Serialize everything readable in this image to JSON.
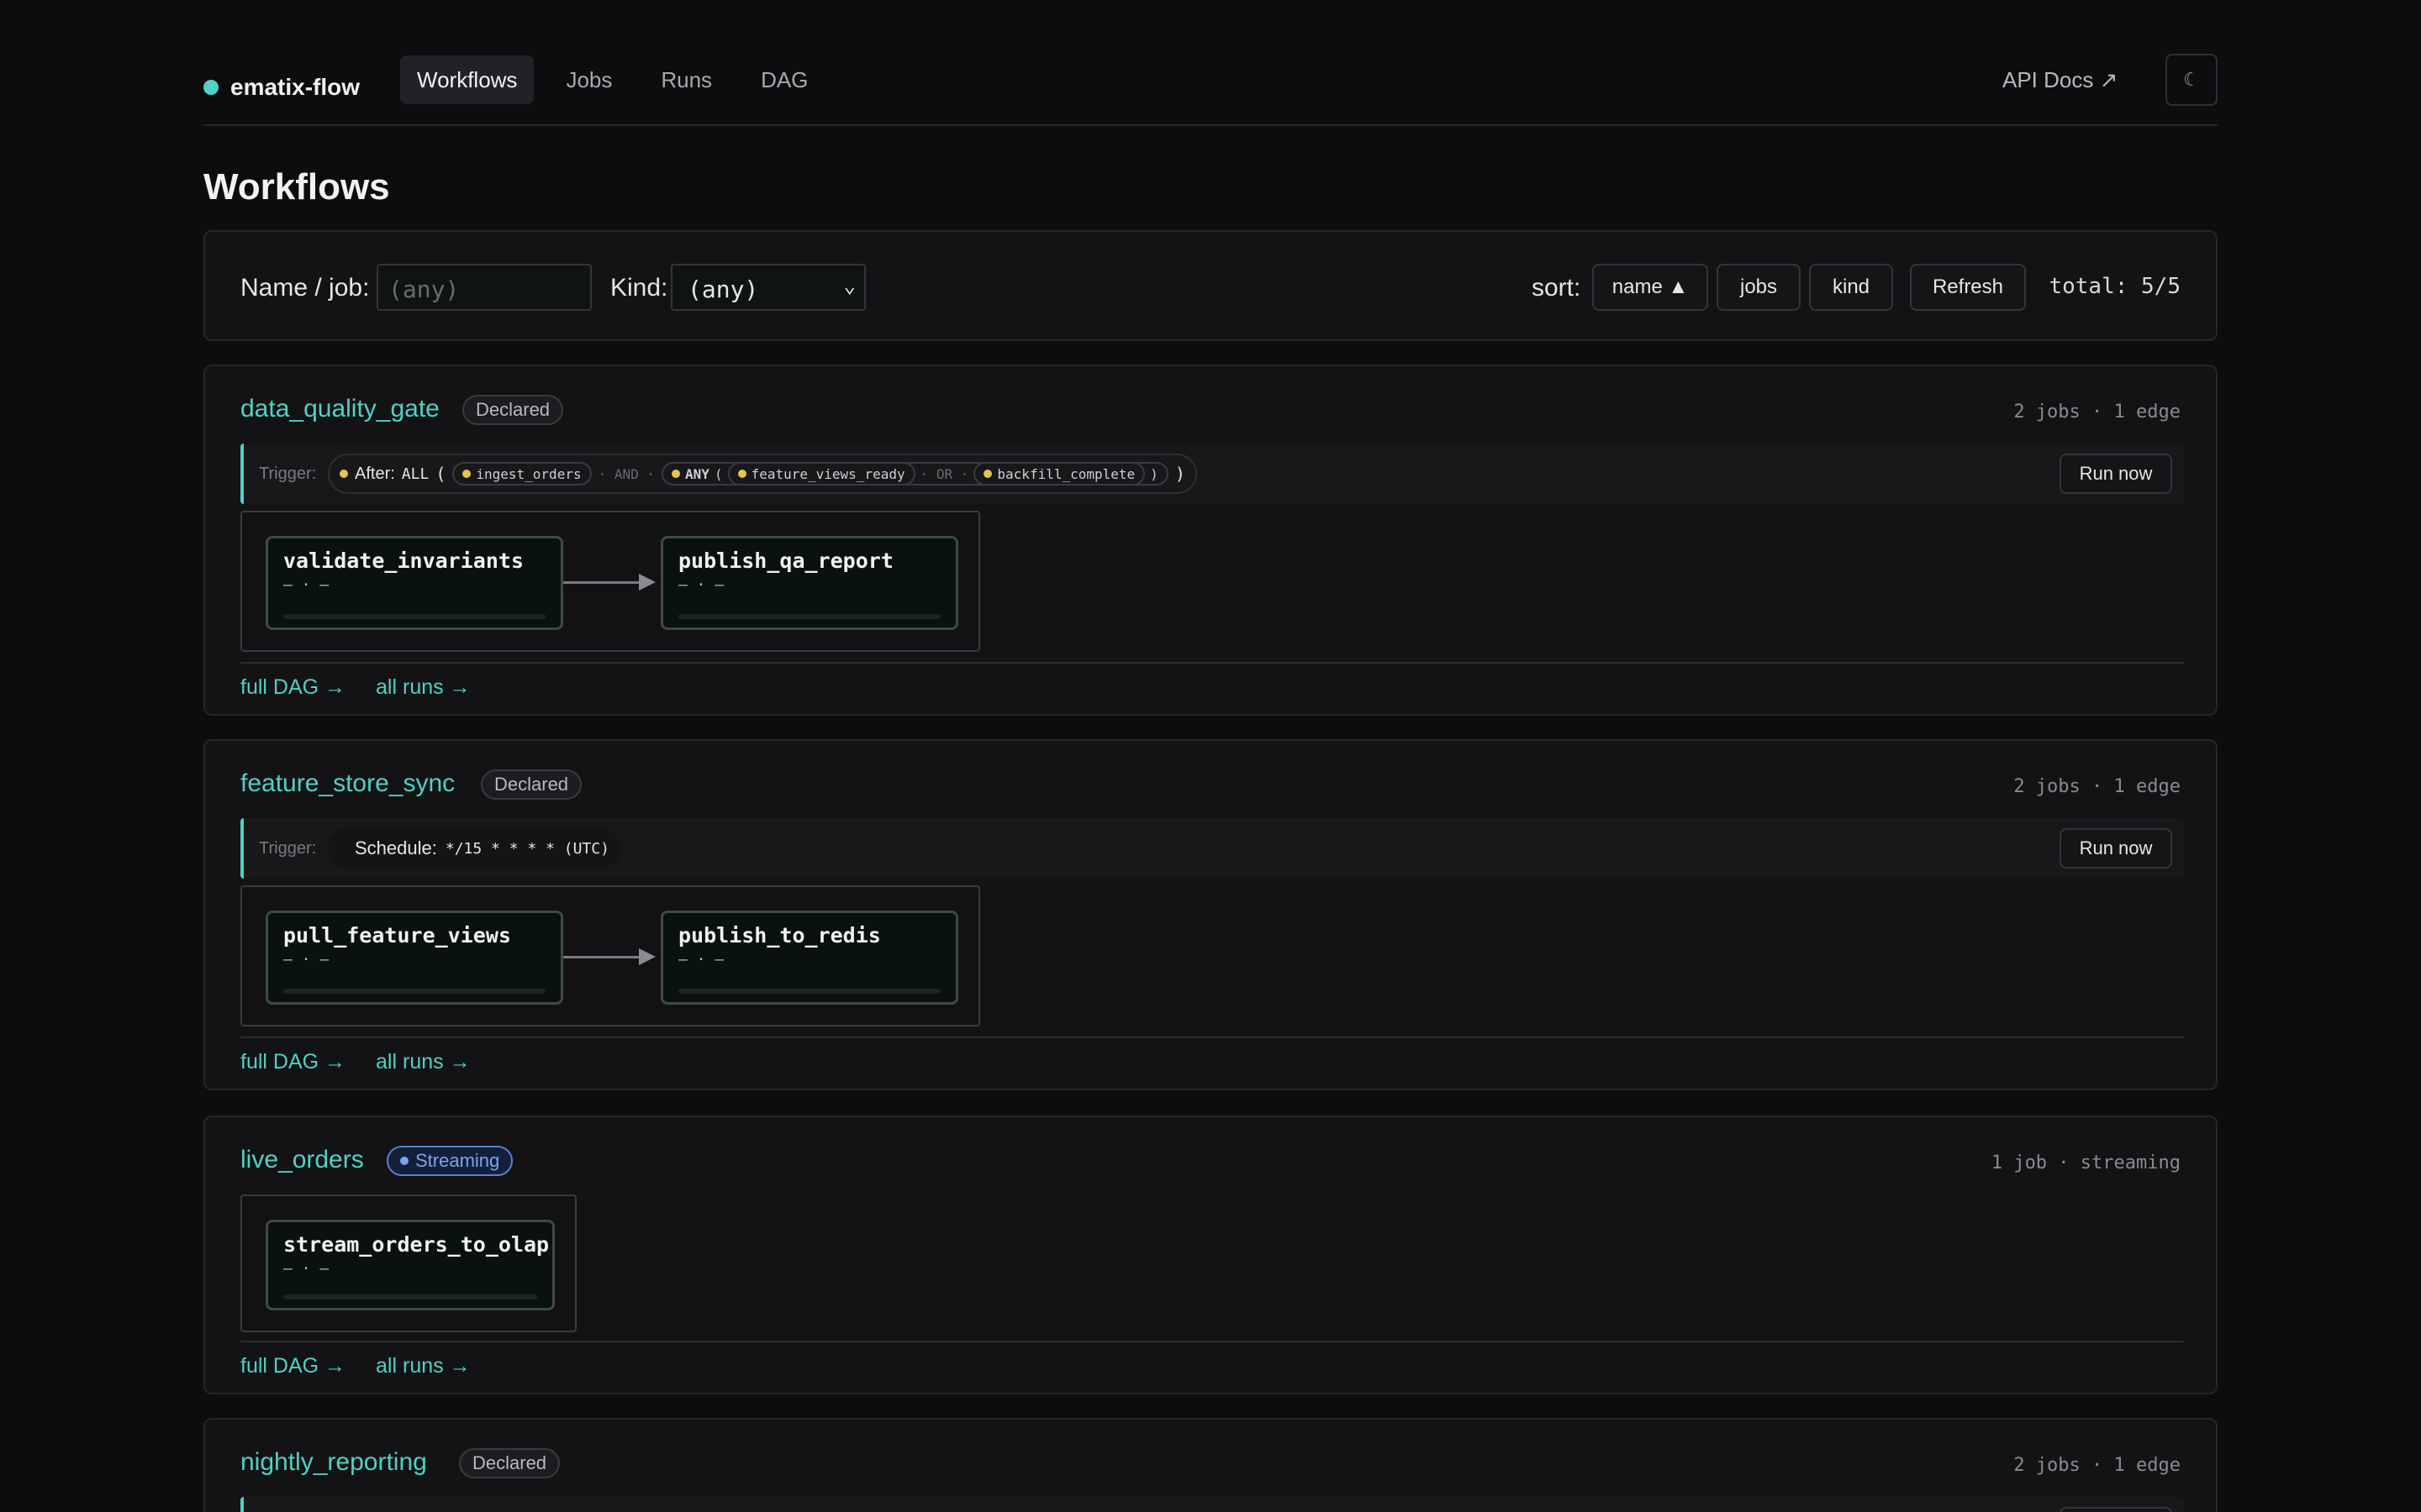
{
  "brand": {
    "name": "ematix-flow"
  },
  "nav": {
    "items": [
      "Workflows",
      "Jobs",
      "Runs",
      "DAG"
    ],
    "api_docs": "API Docs ↗",
    "theme_icon": "☾"
  },
  "page": {
    "title": "Workflows"
  },
  "filters": {
    "name_label": "Name / job:",
    "name_placeholder": "(any)",
    "kind_label": "Kind:",
    "kind_value": "(any)",
    "sort_label": "sort:",
    "sort_buttons": [
      "name ▲",
      "jobs",
      "kind"
    ],
    "refresh": "Refresh",
    "total": "total: 5/5"
  },
  "common": {
    "trigger_label": "Trigger:",
    "run_now": "Run now",
    "full_dag": "full DAG →",
    "all_runs": "all runs →",
    "node_sub": "– · –"
  },
  "workflows": [
    {
      "name": "data_quality_gate",
      "badge": "Declared",
      "meta": "2 jobs · 1 edge",
      "trigger": {
        "prefix": "After:",
        "all": "ALL",
        "open": "(",
        "chip1": "ingest_orders",
        "and": "· AND ·",
        "any": "ANY",
        "open2": "(",
        "chip2": "feature_views_ready",
        "or": "· OR ·",
        "chip3": "backfill_complete",
        "close2": ")",
        "close": ")"
      },
      "nodes": [
        "validate_invariants",
        "publish_qa_report"
      ]
    },
    {
      "name": "feature_store_sync",
      "badge": "Declared",
      "meta": "2 jobs · 1 edge",
      "trigger": {
        "prefix": "Schedule:",
        "cron": "*/15 * * * * (UTC)"
      },
      "nodes": [
        "pull_feature_views",
        "publish_to_redis"
      ]
    },
    {
      "name": "live_orders",
      "badge": "Streaming",
      "meta": "1 job · streaming",
      "nodes": [
        "stream_orders_to_olap"
      ]
    },
    {
      "name": "nightly_reporting",
      "badge": "Declared",
      "meta": "2 jobs · 1 edge"
    }
  ]
}
